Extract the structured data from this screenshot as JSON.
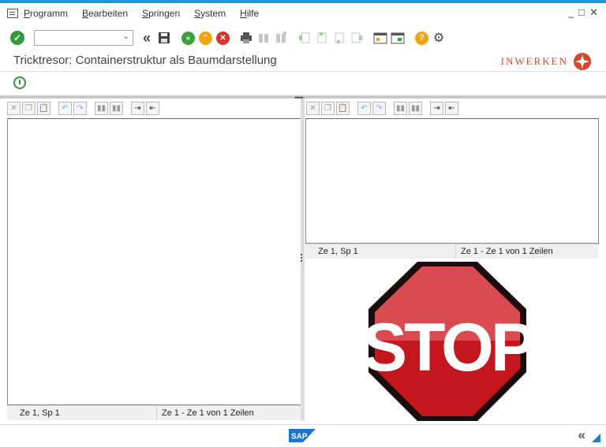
{
  "menu": {
    "items": [
      {
        "key": "P",
        "rest": "rogramm"
      },
      {
        "key": "B",
        "rest": "earbeiten"
      },
      {
        "key": "S",
        "rest": "pringen"
      },
      {
        "key": "S",
        "rest": "ystem"
      },
      {
        "key": "H",
        "rest": "ilfe"
      }
    ]
  },
  "window_controls": {
    "minimize": "_",
    "maximize": "□",
    "close": "✕"
  },
  "command_field": {
    "value": ""
  },
  "toolbar": {
    "ok": "✓",
    "back_icon": "«",
    "save_icon": "💾",
    "nav_back": "«",
    "nav_up": "⌃",
    "nav_cancel": "✕",
    "help": "?",
    "settings": "⚙"
  },
  "title": "Tricktresor: Containerstruktur als Baumdarstellung",
  "logo": {
    "text": "INWERKEN",
    "accent": "#d9472b"
  },
  "left_panel": {
    "status": {
      "position": "Ze 1, Sp 1",
      "lines": "Ze 1 - Ze 1 von 1 Zeilen"
    }
  },
  "right_panel": {
    "status": {
      "position": "Ze 1, Sp 1",
      "lines": "Ze 1 - Ze 1 von 1 Zeilen"
    }
  },
  "stop_sign": {
    "text": "STOP",
    "color": "#c4161c"
  },
  "footer": {
    "sap_label": "SAP",
    "collapse": "«"
  },
  "colors": {
    "accent": "#1a9bd7",
    "ok_green": "#2e9c3a",
    "nav_green": "#3aa03a",
    "nav_orange": "#f2a20a",
    "nav_red": "#d9322b",
    "help_orange": "#f2a20a"
  }
}
